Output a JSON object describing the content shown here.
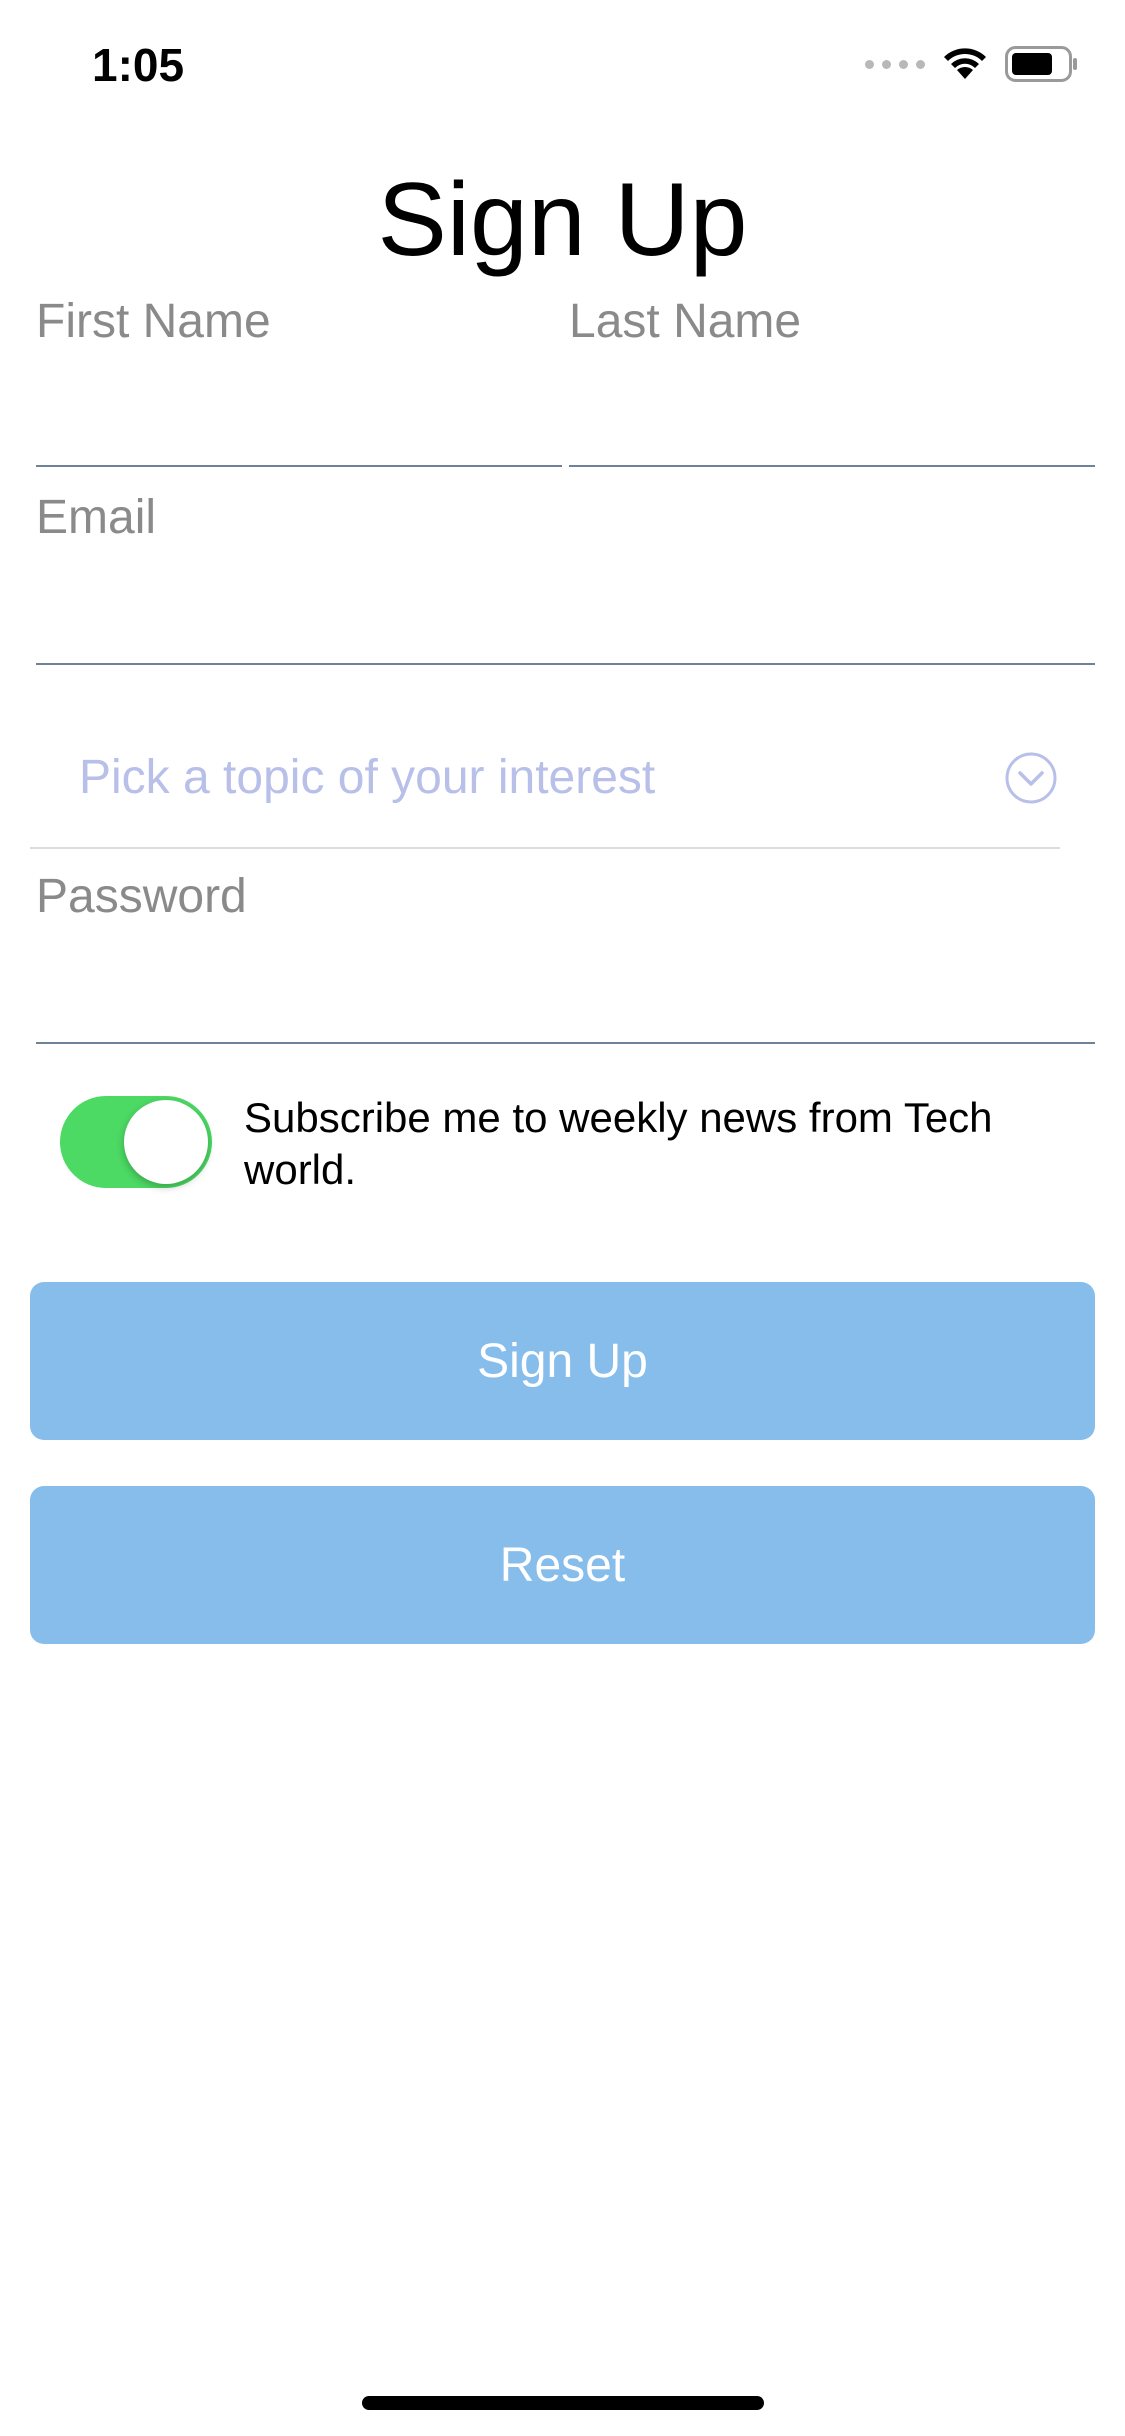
{
  "status_bar": {
    "time": "1:05"
  },
  "page": {
    "title": "Sign Up"
  },
  "form": {
    "first_name_label": "First Name",
    "last_name_label": "Last Name",
    "email_label": "Email",
    "topic_placeholder": "Pick a topic of your interest",
    "password_label": "Password",
    "subscribe_text": "Subscribe me to weekly news from Tech world.",
    "subscribe_on": true
  },
  "buttons": {
    "sign_up_label": "Sign Up",
    "reset_label": "Reset"
  },
  "colors": {
    "accent_button": "#87bdeb",
    "toggle_on": "#4cd964",
    "placeholder": "#b8bfe8",
    "label": "#8a8a8a"
  },
  "icons": {
    "cellular": "signal-dots-icon",
    "wifi": "wifi-icon",
    "battery": "battery-icon",
    "topic_dropdown": "chevron-down-circle-icon"
  }
}
